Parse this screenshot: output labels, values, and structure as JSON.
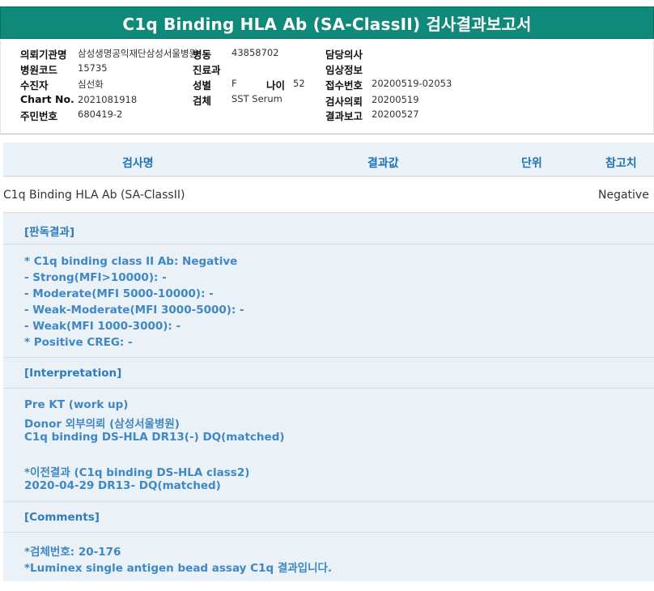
{
  "title": "C1q Binding HLA Ab (SA-ClassII) 검사결과보고서",
  "info": {
    "institution_label": "의뢰기관명",
    "institution_value": "삼성생명공익재단삼성서울병원",
    "ward_label": "병동",
    "ward_value": "43858702",
    "doctor_label": "담당의사",
    "hospital_code_label": "병원코드",
    "hospital_code_value": "15735",
    "dept_label": "진료과",
    "clinical_label": "임상정보",
    "recipient_label": "수진자",
    "recipient_value": "심선화",
    "sex_label": "성별",
    "sex_value": "F",
    "age_label": "나이",
    "age_value": "52",
    "reception_label": "접수번호",
    "reception_value": "20200519-02053",
    "chart_label": "Chart No.",
    "chart_value": "2021081918",
    "specimen_label": "검체",
    "specimen_value": "SST Serum",
    "request_label": "검사의뢰",
    "request_value": "20200519",
    "rrn_label": "주민번호",
    "rrn_value": "680419-2",
    "report_label": "결과보고",
    "report_value": "20200527"
  },
  "table": {
    "headers": {
      "test": "검사명",
      "result": "결과값",
      "unit": "단위",
      "reference": "참고치"
    },
    "row": {
      "test": "C1q Binding HLA Ab (SA-ClassII)",
      "result": "",
      "unit": "",
      "reference": "Negative"
    }
  },
  "judgement": {
    "title": "[판독결과]",
    "lines": [
      "* C1q binding class II Ab: Negative",
      "- Strong(MFI>10000): -",
      "- Moderate(MFI 5000-10000): -",
      "- Weak-Moderate(MFI 3000-5000): -",
      "- Weak(MFI 1000-3000): -",
      "* Positive CREG: -"
    ]
  },
  "interpretation": {
    "title": "[Interpretation]",
    "lines": [
      "Pre KT (work up)",
      "Donor 외부의뢰 (삼성서울병원)",
      "C1q binding DS-HLA DR13(-) DQ(matched)",
      "",
      "*이전결과 (C1q binding DS-HLA class2)",
      "2020-04-29 DR13- DQ(matched)"
    ]
  },
  "comments": {
    "title": "[Comments]",
    "lines": [
      "*검체번호: 20-176",
      "*Luminex single antigen bead assay C1q 결과입니다."
    ]
  }
}
